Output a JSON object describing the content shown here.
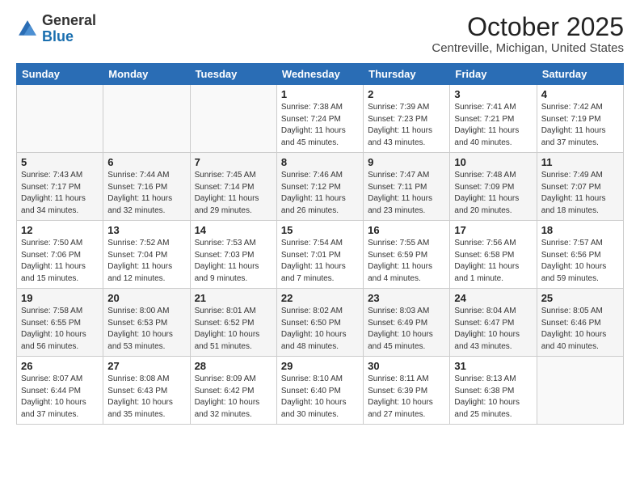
{
  "logo": {
    "general": "General",
    "blue": "Blue"
  },
  "title": "October 2025",
  "subtitle": "Centreville, Michigan, United States",
  "weekdays": [
    "Sunday",
    "Monday",
    "Tuesday",
    "Wednesday",
    "Thursday",
    "Friday",
    "Saturday"
  ],
  "weeks": [
    [
      {
        "day": "",
        "info": ""
      },
      {
        "day": "",
        "info": ""
      },
      {
        "day": "",
        "info": ""
      },
      {
        "day": "1",
        "info": "Sunrise: 7:38 AM\nSunset: 7:24 PM\nDaylight: 11 hours\nand 45 minutes."
      },
      {
        "day": "2",
        "info": "Sunrise: 7:39 AM\nSunset: 7:23 PM\nDaylight: 11 hours\nand 43 minutes."
      },
      {
        "day": "3",
        "info": "Sunrise: 7:41 AM\nSunset: 7:21 PM\nDaylight: 11 hours\nand 40 minutes."
      },
      {
        "day": "4",
        "info": "Sunrise: 7:42 AM\nSunset: 7:19 PM\nDaylight: 11 hours\nand 37 minutes."
      }
    ],
    [
      {
        "day": "5",
        "info": "Sunrise: 7:43 AM\nSunset: 7:17 PM\nDaylight: 11 hours\nand 34 minutes."
      },
      {
        "day": "6",
        "info": "Sunrise: 7:44 AM\nSunset: 7:16 PM\nDaylight: 11 hours\nand 32 minutes."
      },
      {
        "day": "7",
        "info": "Sunrise: 7:45 AM\nSunset: 7:14 PM\nDaylight: 11 hours\nand 29 minutes."
      },
      {
        "day": "8",
        "info": "Sunrise: 7:46 AM\nSunset: 7:12 PM\nDaylight: 11 hours\nand 26 minutes."
      },
      {
        "day": "9",
        "info": "Sunrise: 7:47 AM\nSunset: 7:11 PM\nDaylight: 11 hours\nand 23 minutes."
      },
      {
        "day": "10",
        "info": "Sunrise: 7:48 AM\nSunset: 7:09 PM\nDaylight: 11 hours\nand 20 minutes."
      },
      {
        "day": "11",
        "info": "Sunrise: 7:49 AM\nSunset: 7:07 PM\nDaylight: 11 hours\nand 18 minutes."
      }
    ],
    [
      {
        "day": "12",
        "info": "Sunrise: 7:50 AM\nSunset: 7:06 PM\nDaylight: 11 hours\nand 15 minutes."
      },
      {
        "day": "13",
        "info": "Sunrise: 7:52 AM\nSunset: 7:04 PM\nDaylight: 11 hours\nand 12 minutes."
      },
      {
        "day": "14",
        "info": "Sunrise: 7:53 AM\nSunset: 7:03 PM\nDaylight: 11 hours\nand 9 minutes."
      },
      {
        "day": "15",
        "info": "Sunrise: 7:54 AM\nSunset: 7:01 PM\nDaylight: 11 hours\nand 7 minutes."
      },
      {
        "day": "16",
        "info": "Sunrise: 7:55 AM\nSunset: 6:59 PM\nDaylight: 11 hours\nand 4 minutes."
      },
      {
        "day": "17",
        "info": "Sunrise: 7:56 AM\nSunset: 6:58 PM\nDaylight: 11 hours\nand 1 minute."
      },
      {
        "day": "18",
        "info": "Sunrise: 7:57 AM\nSunset: 6:56 PM\nDaylight: 10 hours\nand 59 minutes."
      }
    ],
    [
      {
        "day": "19",
        "info": "Sunrise: 7:58 AM\nSunset: 6:55 PM\nDaylight: 10 hours\nand 56 minutes."
      },
      {
        "day": "20",
        "info": "Sunrise: 8:00 AM\nSunset: 6:53 PM\nDaylight: 10 hours\nand 53 minutes."
      },
      {
        "day": "21",
        "info": "Sunrise: 8:01 AM\nSunset: 6:52 PM\nDaylight: 10 hours\nand 51 minutes."
      },
      {
        "day": "22",
        "info": "Sunrise: 8:02 AM\nSunset: 6:50 PM\nDaylight: 10 hours\nand 48 minutes."
      },
      {
        "day": "23",
        "info": "Sunrise: 8:03 AM\nSunset: 6:49 PM\nDaylight: 10 hours\nand 45 minutes."
      },
      {
        "day": "24",
        "info": "Sunrise: 8:04 AM\nSunset: 6:47 PM\nDaylight: 10 hours\nand 43 minutes."
      },
      {
        "day": "25",
        "info": "Sunrise: 8:05 AM\nSunset: 6:46 PM\nDaylight: 10 hours\nand 40 minutes."
      }
    ],
    [
      {
        "day": "26",
        "info": "Sunrise: 8:07 AM\nSunset: 6:44 PM\nDaylight: 10 hours\nand 37 minutes."
      },
      {
        "day": "27",
        "info": "Sunrise: 8:08 AM\nSunset: 6:43 PM\nDaylight: 10 hours\nand 35 minutes."
      },
      {
        "day": "28",
        "info": "Sunrise: 8:09 AM\nSunset: 6:42 PM\nDaylight: 10 hours\nand 32 minutes."
      },
      {
        "day": "29",
        "info": "Sunrise: 8:10 AM\nSunset: 6:40 PM\nDaylight: 10 hours\nand 30 minutes."
      },
      {
        "day": "30",
        "info": "Sunrise: 8:11 AM\nSunset: 6:39 PM\nDaylight: 10 hours\nand 27 minutes."
      },
      {
        "day": "31",
        "info": "Sunrise: 8:13 AM\nSunset: 6:38 PM\nDaylight: 10 hours\nand 25 minutes."
      },
      {
        "day": "",
        "info": ""
      }
    ]
  ]
}
